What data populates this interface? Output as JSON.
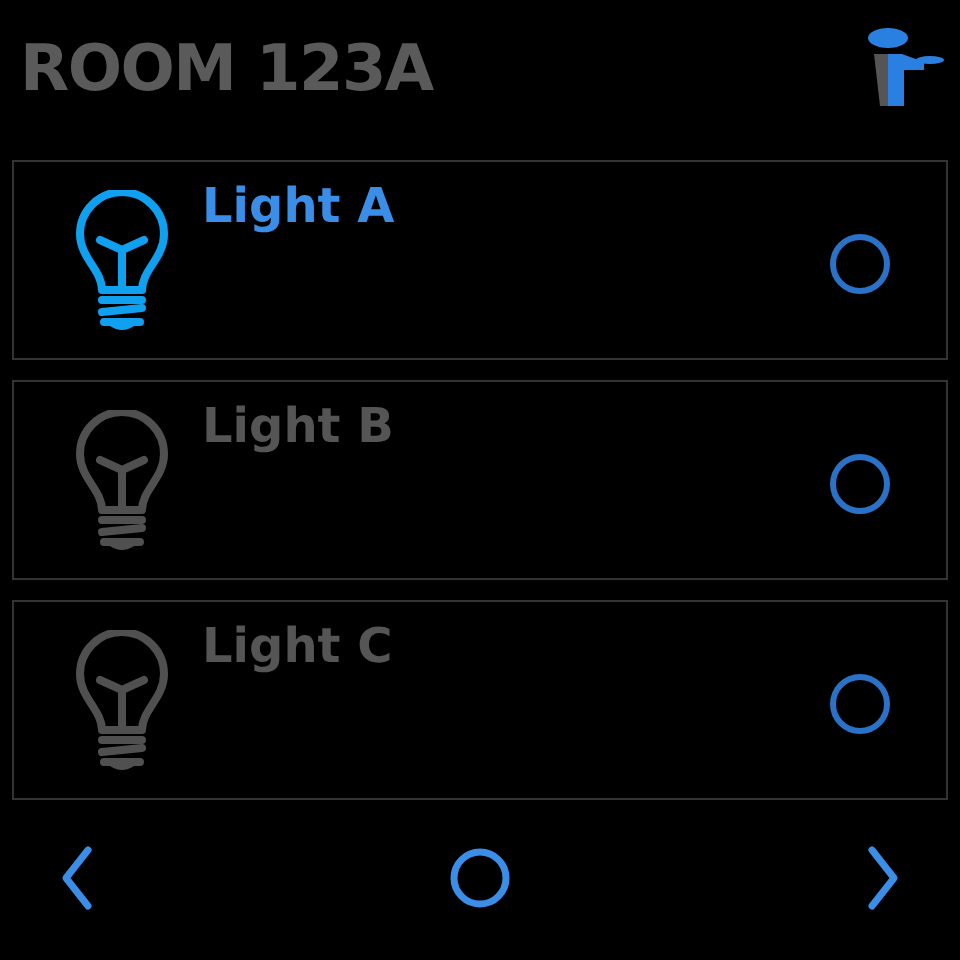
{
  "title": "ROOM 123A",
  "lights": [
    {
      "label": "Light A",
      "on": true
    },
    {
      "label": "Light B",
      "on": false
    },
    {
      "label": "Light C",
      "on": false
    }
  ]
}
